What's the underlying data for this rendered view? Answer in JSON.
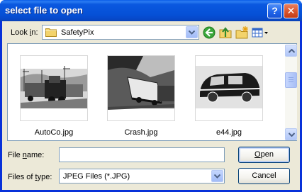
{
  "window": {
    "title": "select file to open",
    "help_label": "?",
    "close_label": "✕"
  },
  "lookin": {
    "label_pre": "Look ",
    "label_accel": "i",
    "label_post": "n:",
    "value": "SafetyPix",
    "icon": "folder-icon"
  },
  "toolbar": {
    "icons": [
      "back-icon",
      "up-folder-icon",
      "new-folder-icon",
      "view-menu-icon"
    ]
  },
  "files": [
    {
      "name": "AutoCo.jpg"
    },
    {
      "name": "Crash.jpg"
    },
    {
      "name": "e44.jpg"
    }
  ],
  "filename": {
    "label_pre": "File ",
    "label_accel": "n",
    "label_post": "ame:",
    "value": ""
  },
  "filetype": {
    "label_pre": "Files of ",
    "label_accel": "t",
    "label_post": "ype:",
    "value": "JPEG Files (*.JPG)"
  },
  "buttons": {
    "open_accel": "O",
    "open_rest": "pen",
    "cancel": "Cancel"
  },
  "colors": {
    "title_bar": "#0a58e0",
    "dialog_bg": "#ece9d8",
    "field_border": "#7f9db9"
  }
}
